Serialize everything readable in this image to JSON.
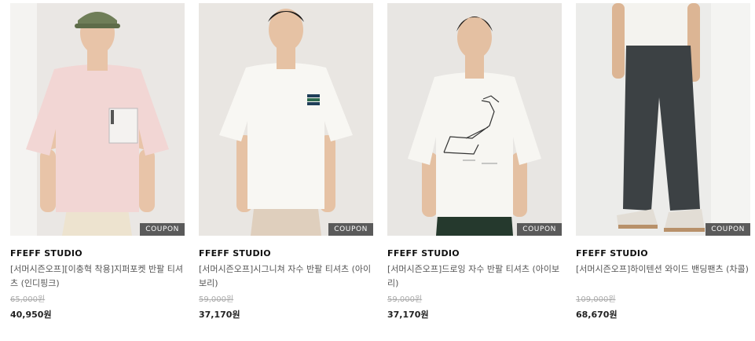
{
  "products": [
    {
      "brand": "FFEFF STUDIO",
      "name": "[서머시즌오프][이충혁 착용]지퍼포켓 반팔 티셔츠 (인디핑크)",
      "original_price": "65,000원",
      "sale_price": "40,950원",
      "badge": "COUPON",
      "colors": {
        "bg": "#eae7e4",
        "shirt": "#f2d6d4",
        "pants": "#ede3cf",
        "skin": "#e8c4a8",
        "hair": "#2a2622"
      }
    },
    {
      "brand": "FFEFF STUDIO",
      "name": "[서머시즌오프]시그니쳐 자수 반팔 티셔츠 (아이보리)",
      "original_price": "59,000원",
      "sale_price": "37,170원",
      "badge": "COUPON",
      "colors": {
        "bg": "#e9e6e2",
        "shirt": "#f8f7f3",
        "pants": "#dfcfbd",
        "skin": "#e6c2a4",
        "hair": "#1e1b19"
      }
    },
    {
      "brand": "FFEFF STUDIO",
      "name": "[서머시즌오프]드로잉 자수 반팔 티셔츠 (아이보리)",
      "original_price": "59,000원",
      "sale_price": "37,170원",
      "badge": "COUPON",
      "colors": {
        "bg": "#e8e6e3",
        "shirt": "#f7f6f2",
        "pants": "#25392d",
        "skin": "#e4c0a2",
        "hair": "#231f1c"
      }
    },
    {
      "brand": "FFEFF STUDIO",
      "name": "[서머시즌오프]하이텐션 와이드 밴딩팬츠 (차콜)",
      "original_price": "109,000원",
      "sale_price": "68,670원",
      "badge": "COUPON",
      "colors": {
        "bg": "#ececea",
        "shirt": "#f4f3ef",
        "pants": "#3c4144",
        "skin": "#dcb594",
        "shoe": "#e2ddd5"
      }
    }
  ]
}
